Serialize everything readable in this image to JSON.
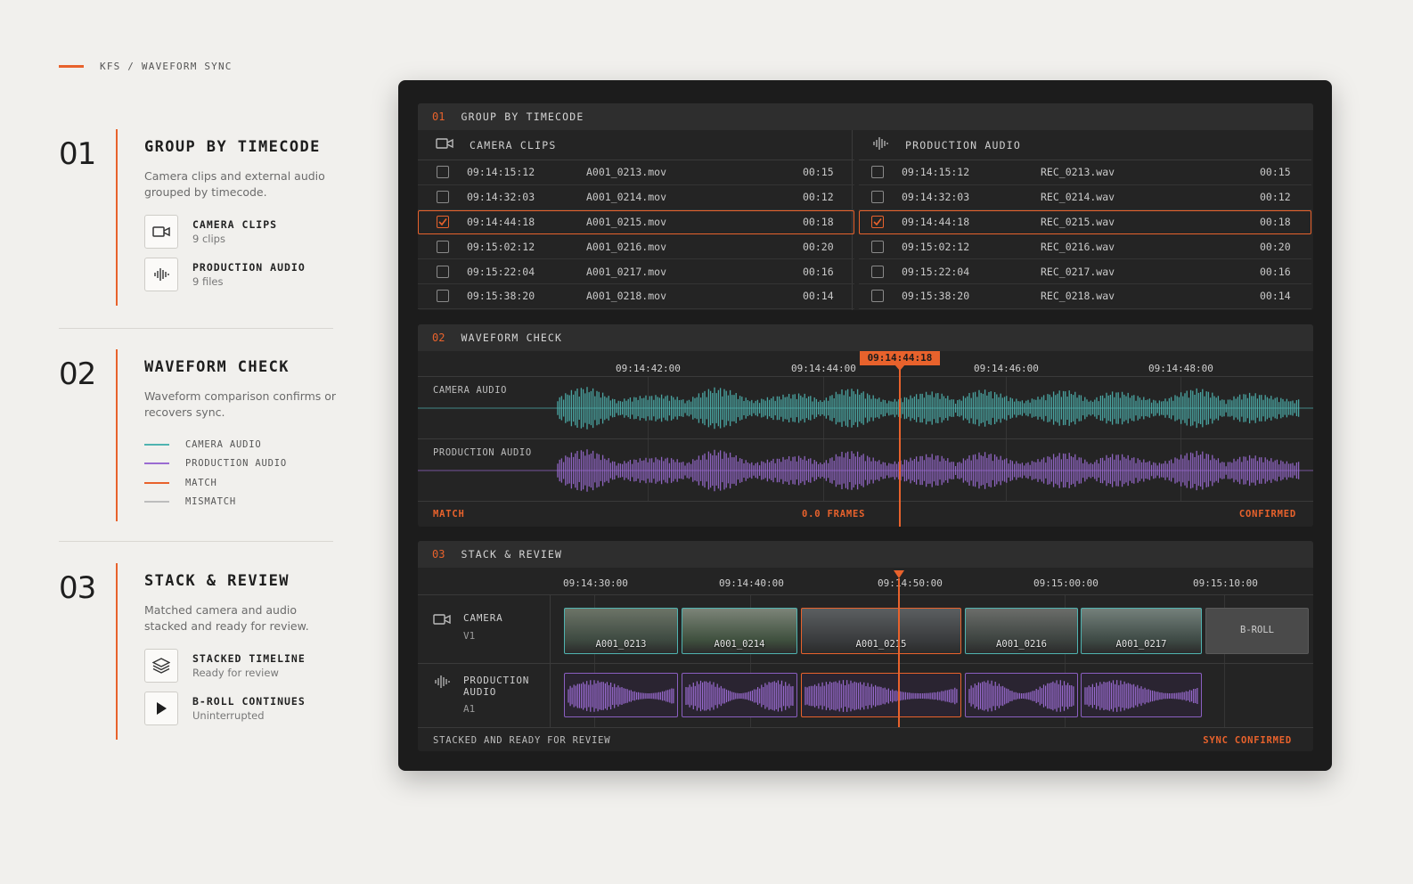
{
  "breadcrumb": "KFS / WAVEFORM SYNC",
  "steps": [
    {
      "num": "01",
      "title": "GROUP BY TIMECODE",
      "desc": "Camera clips and external audio grouped by timecode.",
      "features": [
        {
          "title": "CAMERA CLIPS",
          "sub": "9 clips",
          "icon": "video-camera-icon"
        },
        {
          "title": "PRODUCTION AUDIO",
          "sub": "9 files",
          "icon": "waveform-icon"
        }
      ]
    },
    {
      "num": "02",
      "title": "WAVEFORM CHECK",
      "desc": "Waveform comparison confirms or recovers sync.",
      "legend": [
        {
          "label": "CAMERA AUDIO",
          "color": "#4fb3b0"
        },
        {
          "label": "PRODUCTION AUDIO",
          "color": "#9a6bd1"
        },
        {
          "label": "MATCH",
          "color": "#e8622c"
        },
        {
          "label": "MISMATCH",
          "color": "#bdbdbd"
        }
      ]
    },
    {
      "num": "03",
      "title": "STACK & REVIEW",
      "desc": "Matched camera and audio stacked and ready for review.",
      "features": [
        {
          "title": "STACKED TIMELINE",
          "sub": "Ready for review",
          "icon": "layers-icon"
        },
        {
          "title": "B-ROLL CONTINUES",
          "sub": "Uninterrupted",
          "icon": "play-icon"
        }
      ]
    }
  ],
  "panel": {
    "group": {
      "num": "01",
      "title": "GROUP BY TIMECODE",
      "camera_title": "CAMERA CLIPS",
      "audio_title": "PRODUCTION AUDIO",
      "camera_rows": [
        {
          "tc": "09:14:15:12",
          "file": "A001_0213.mov",
          "dur": "00:15",
          "checked": false
        },
        {
          "tc": "09:14:32:03",
          "file": "A001_0214.mov",
          "dur": "00:12",
          "checked": false
        },
        {
          "tc": "09:14:44:18",
          "file": "A001_0215.mov",
          "dur": "00:18",
          "checked": true
        },
        {
          "tc": "09:15:02:12",
          "file": "A001_0216.mov",
          "dur": "00:20",
          "checked": false
        },
        {
          "tc": "09:15:22:04",
          "file": "A001_0217.mov",
          "dur": "00:16",
          "checked": false
        },
        {
          "tc": "09:15:38:20",
          "file": "A001_0218.mov",
          "dur": "00:14",
          "checked": false
        }
      ],
      "audio_rows": [
        {
          "tc": "09:14:15:12",
          "file": "REC_0213.wav",
          "dur": "00:15",
          "checked": false
        },
        {
          "tc": "09:14:32:03",
          "file": "REC_0214.wav",
          "dur": "00:12",
          "checked": false
        },
        {
          "tc": "09:14:44:18",
          "file": "REC_0215.wav",
          "dur": "00:18",
          "checked": true
        },
        {
          "tc": "09:15:02:12",
          "file": "REC_0216.wav",
          "dur": "00:20",
          "checked": false
        },
        {
          "tc": "09:15:22:04",
          "file": "REC_0217.wav",
          "dur": "00:16",
          "checked": false
        },
        {
          "tc": "09:15:38:20",
          "file": "REC_0218.wav",
          "dur": "00:14",
          "checked": false
        }
      ]
    },
    "waveform": {
      "num": "02",
      "title": "WAVEFORM CHECK",
      "ruler": [
        "09:14:42:00",
        "09:14:44:00",
        "09:14:46:00",
        "09:14:48:00"
      ],
      "playhead": "09:14:44:18",
      "lanes": [
        "CAMERA AUDIO",
        "PRODUCTION AUDIO"
      ],
      "status_left": "MATCH",
      "status_mid": "0.0 FRAMES",
      "status_right": "CONFIRMED"
    },
    "stack": {
      "num": "03",
      "title": "STACK & REVIEW",
      "ruler": [
        "09:14:30:00",
        "09:14:40:00",
        "09:14:50:00",
        "09:15:00:00",
        "09:15:10:00"
      ],
      "camera_track": {
        "name": "CAMERA",
        "id": "V1"
      },
      "audio_track": {
        "name": "PRODUCTION\nAUDIO",
        "id": "A1"
      },
      "clips": [
        "A001_0213",
        "A001_0214",
        "A001_0215",
        "A001_0216",
        "A001_0217"
      ],
      "broll": "B-ROLL",
      "footer_left": "STACKED AND READY FOR REVIEW",
      "footer_right": "SYNC CONFIRMED"
    }
  },
  "colors": {
    "accent": "#e8622c",
    "camera_wave": "#4fb3b0",
    "audio_wave": "#9a6bd1"
  }
}
